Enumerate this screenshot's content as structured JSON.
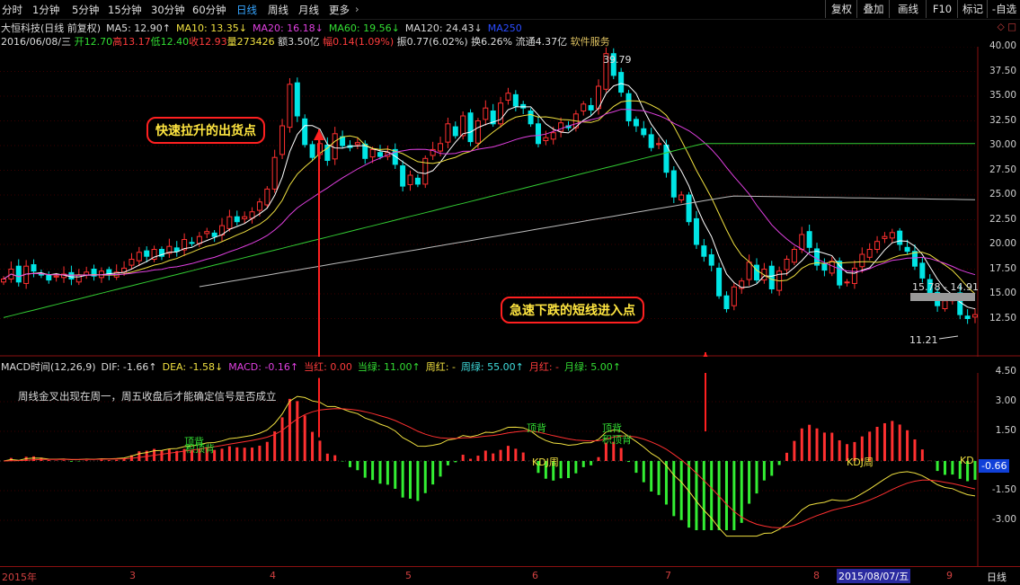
{
  "toolbar": {
    "periods": [
      "分时",
      "1分钟",
      "5分钟",
      "15分钟",
      "30分钟",
      "60分钟",
      "日线",
      "周线",
      "月线",
      "更多"
    ],
    "active": "日线",
    "right_buttons": [
      "复权",
      "叠加",
      "画线",
      "F10",
      "标记",
      "-自选"
    ]
  },
  "header": {
    "stock_name": "大恒科技(日线 前复权)",
    "ma5": "MA5: 12.90↑",
    "ma10": "MA10: 13.35↓",
    "ma20": "MA20: 16.18↓",
    "ma60": "MA60: 19.56↓",
    "ma120": "MA120: 24.43↓",
    "ma250": "MA250",
    "date": "2016/06/08/三",
    "open": "开12.70",
    "high": "高13.17",
    "low": "低12.40",
    "close": "收12.93",
    "volume": "量273426",
    "amount": "额3.50亿",
    "change": "幅0.14(1.09%)",
    "amplitude": "振0.77(6.02%)",
    "turnover": "换6.26%",
    "float_cap": "流通4.37亿",
    "sector": "软件服务"
  },
  "price_axis": [
    "40.00",
    "37.50",
    "35.00",
    "32.50",
    "30.00",
    "27.50",
    "25.00",
    "22.50",
    "20.00",
    "17.50",
    "15.00",
    "12.50"
  ],
  "price_annotations": {
    "high": "39.79",
    "low": "11.21",
    "range": "15.78 - 14.91"
  },
  "callouts": {
    "top": "快速拉升的出货点",
    "bottom": "急速下跌的短线进入点"
  },
  "macd": {
    "title": "MACD时间(12,26,9)",
    "dif": "DIF: -1.66↑",
    "dea": "DEA: -1.58↓",
    "macd": "MACD: -0.16↑",
    "red_today": "当红: 0.00",
    "green_today": "当绿: 11.00↑",
    "week_red": "周红: -",
    "week_green": "周绿: 55.00↑",
    "month_red": "月红: -",
    "month_green": "月绿: 5.00↑",
    "axis": [
      "4.50",
      "3.00",
      "1.50",
      "-1.50",
      "-3.00"
    ],
    "current_value": "-0.66",
    "note": "周线金叉出现在周一，周五收盘后才能确定信号是否成立",
    "labels": {
      "top_div1": "顶背",
      "div1": "积顶背",
      "top_div2": "顶背",
      "div2": "积顶背",
      "kdj1": "KDJ周",
      "kdj2": "KDJ周",
      "kd": "KD"
    }
  },
  "bottom_axis": {
    "ticks": [
      "2015年",
      "3",
      "4",
      "5",
      "6",
      "7",
      "8",
      "9"
    ],
    "current_date": "2015/08/07/五",
    "right_label": "日线"
  },
  "colors": {
    "up": "#ff3030",
    "down": "#00e5e5",
    "ma5": "#ffffff",
    "ma10": "#f0e040",
    "ma20": "#e040e0",
    "ma60": "#33cc33",
    "ma120": "#bbbbbb",
    "arrow": "#ff2020"
  },
  "chart_data": {
    "type": "candlestick",
    "price_range": [
      11,
      41
    ],
    "closes": [
      16.5,
      17.5,
      16.2,
      17.8,
      17.3,
      16.9,
      16.4,
      16.8,
      17.0,
      16.5,
      16.9,
      17.2,
      16.8,
      17.3,
      17.0,
      17.2,
      17.6,
      18.5,
      19.2,
      18.8,
      19.5,
      18.8,
      19.8,
      19.3,
      20.5,
      20.1,
      20.8,
      21.3,
      20.8,
      21.9,
      22.8,
      22.3,
      22.8,
      23.3,
      24.3,
      25.6,
      28.8,
      32.0,
      36.2,
      33.0,
      30.1,
      28.8,
      30.2,
      28.5,
      31.2,
      30.0,
      29.8,
      30.3,
      28.7,
      29.6,
      28.9,
      29.3,
      28.1,
      25.9,
      27.0,
      26.1,
      28.7,
      29.6,
      30.2,
      32.2,
      31.0,
      33.0,
      30.4,
      32.5,
      33.8,
      32.2,
      34.3,
      35.3,
      34.0,
      33.8,
      32.2,
      30.2,
      30.8,
      31.3,
      32.3,
      31.8,
      33.2,
      34.2,
      33.6,
      36.0,
      39.3,
      37.1,
      35.4,
      32.5,
      32.0,
      31.1,
      29.8,
      30.2,
      27.3,
      24.8,
      25.0,
      22.3,
      20.0,
      18.8,
      17.9,
      14.8,
      13.5,
      15.7,
      16.3,
      18.2,
      16.4,
      17.5,
      15.5,
      17.3,
      18.5,
      19.5,
      21.0,
      19.7,
      17.9,
      17.4,
      18.3,
      15.9,
      16.2,
      17.6,
      19.0,
      19.5,
      20.3,
      20.8,
      21.2,
      20.0,
      19.3,
      17.8,
      16.6,
      15.0,
      13.8,
      14.3,
      14.8,
      12.9,
      12.5,
      12.9
    ]
  }
}
